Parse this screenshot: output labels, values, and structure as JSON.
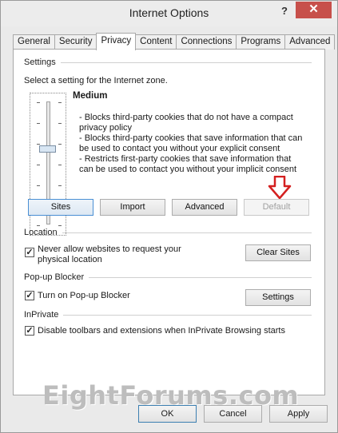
{
  "window": {
    "title": "Internet Options",
    "help": "?",
    "close": "✕"
  },
  "tabs": [
    {
      "label": "General"
    },
    {
      "label": "Security"
    },
    {
      "label": "Privacy",
      "active": true
    },
    {
      "label": "Content"
    },
    {
      "label": "Connections"
    },
    {
      "label": "Programs"
    },
    {
      "label": "Advanced"
    }
  ],
  "settings": {
    "heading": "Settings",
    "zone_label": "Select a setting for the Internet zone.",
    "level": "Medium",
    "descriptions": [
      "- Blocks third-party cookies that do not have a compact",
      "privacy policy",
      "- Blocks third-party cookies that save information that can",
      "be used to contact you without your explicit consent",
      "- Restricts first-party cookies that save information that",
      "can be used to contact you without your implicit consent"
    ],
    "buttons": {
      "sites": "Sites",
      "import": "Import",
      "advanced": "Advanced",
      "default": "Default"
    },
    "arrow_color": "#d42020"
  },
  "location": {
    "heading": "Location",
    "checkbox_line1": "Never allow websites to request your",
    "checkbox_line2": "physical location",
    "checked": true,
    "clear_sites": "Clear Sites"
  },
  "popup": {
    "heading": "Pop-up Blocker",
    "checkbox_label": "Turn on Pop-up Blocker",
    "checked": true,
    "settings": "Settings"
  },
  "inprivate": {
    "heading": "InPrivate",
    "checkbox_label": "Disable toolbars and extensions when InPrivate Browsing starts",
    "checked": true
  },
  "watermark": "EightForums.com",
  "footer": {
    "ok": "OK",
    "cancel": "Cancel",
    "apply": "Apply"
  }
}
